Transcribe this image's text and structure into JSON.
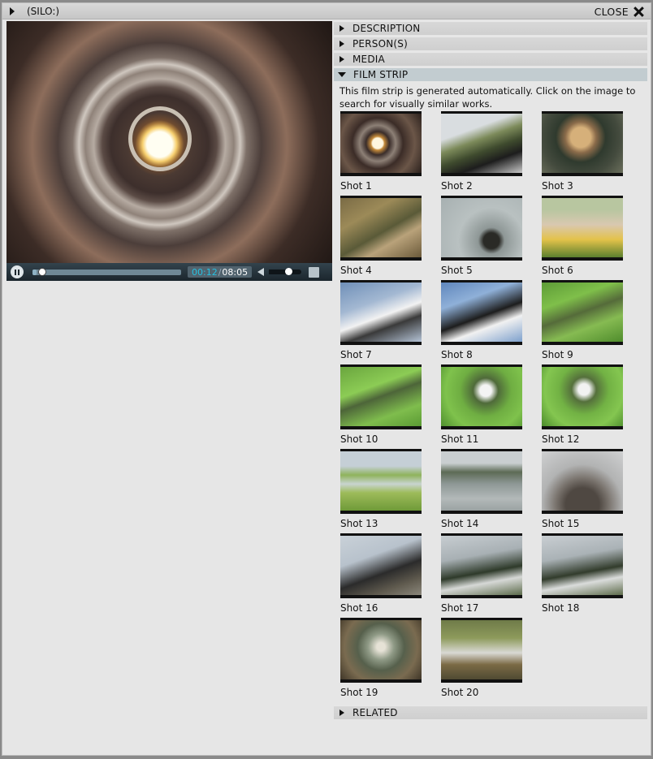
{
  "window": {
    "title": "(SILO:)",
    "close_label": "CLOSE"
  },
  "player": {
    "current_time": "00:12",
    "duration": "08:05",
    "progress": 0.025,
    "volume": 0.6
  },
  "sections": {
    "description": "DESCRIPTION",
    "persons": "PERSON(S)",
    "media": "MEDIA",
    "film_strip": "FILM STRIP",
    "related": "RELATED"
  },
  "film_strip": {
    "note": "This film strip is generated automatically. Click on the image to search for visually similar works.",
    "shots": [
      {
        "label": "Shot 1",
        "bg": "radial-gradient(circle at 46% 50%, #fff7e0 0 10%, #c48a3a 13%, #3a2d2a 22%, #8d8076 34%, #3b2c27 48%, #6b5648 70%, #2a201c)"
      },
      {
        "label": "Shot 2",
        "bg": "linear-gradient(160deg, #d9dde0 0 30%, #7c8a5a 45%, #3f4b2e 60%, #1d1d1d 75%, #c9c9c9)"
      },
      {
        "label": "Shot 3",
        "bg": "radial-gradient(circle at 48% 40%, #d6b07a 0 18%, #8a6b4a 28%, #2f3a2e 45%, #444b3e 70%, #6b6f5c)"
      },
      {
        "label": "Shot 4",
        "bg": "linear-gradient(150deg, #7a6b45 0, #9c8a58 30%, #5a5a38 55%, #b9a27a 70%, #6b5a3a)"
      },
      {
        "label": "Shot 5",
        "bg": "radial-gradient(circle at 62% 72%, #2a2a26 0 12%, #8e9796 20%, #b9c1c1 50%, #a7b0b1)"
      },
      {
        "label": "Shot 6",
        "bg": "linear-gradient(180deg, #b8c6a0 0 20%, #d9c8b0 45%, #e3c24a 70%, #5b7f2e)"
      },
      {
        "label": "Shot 7",
        "bg": "linear-gradient(160deg, #6f8fb8 0, #a3b8d2 35%, #f2f2f2 55%, #3a3a3a 70%, #b4c3d6)"
      },
      {
        "label": "Shot 8",
        "bg": "linear-gradient(160deg, #5f86bc 0, #8fb0d8 30%, #1d1d1d 55%, #f1f1f1 70%, #7da0cc)"
      },
      {
        "label": "Shot 9",
        "bg": "linear-gradient(160deg, #5d9b37 0, #7fbf4a 30%, #556b3a 50%, #86bb52 70%, #4f8c2c)"
      },
      {
        "label": "Shot 10",
        "bg": "linear-gradient(160deg, #6aa53e 0, #8ccc55 35%, #4d6539 50%, #7fbd4d 75%, #5a9a33)"
      },
      {
        "label": "Shot 11",
        "bg": "radial-gradient(circle at 55% 40%, #f4f4f4 0 10%, #4f6a3a 22%, #6fae42 45%, #7fc24c 70%, #4e8e2e)"
      },
      {
        "label": "Shot 12",
        "bg": "radial-gradient(circle at 52% 38%, #f2f2f2 0 10%, #55703c 22%, #72b244 45%, #84c650 70%, #4a8a2b)"
      },
      {
        "label": "Shot 13",
        "bg": "linear-gradient(180deg, #c5cfd6 0 25%, #8fb35c 40%, #c8d4d0 55%, #9dbb5a 70%, #6f9a38)"
      },
      {
        "label": "Shot 14",
        "bg": "linear-gradient(180deg, #c9ced0 0 20%, #5d6b55 35%, #8e9896 55%, #b3b9b9 80%, #9aa2a2)"
      },
      {
        "label": "Shot 15",
        "bg": "radial-gradient(circle at 50% 90%, #4f4842 0 25%, #7b756f 40%, #b2b3b3 60%, #cfd0d1)"
      },
      {
        "label": "Shot 16",
        "bg": "linear-gradient(160deg, #c9d1d8 0, #b8c2cc 35%, #2b2b2b 60%, #5f5a4e 80%, #8c887c)"
      },
      {
        "label": "Shot 17",
        "bg": "linear-gradient(170deg, #c7cdd1 0, #a8b0b4 35%, #2e3a2a 60%, #d6d8d6 75%, #5c6b4b)"
      },
      {
        "label": "Shot 18",
        "bg": "linear-gradient(170deg, #c9ced2 0, #aab2b6 35%, #323c2c 60%, #dadcdb 75%, #5e6c4c)"
      },
      {
        "label": "Shot 19",
        "bg": "radial-gradient(circle at 50% 45%, #e6e2d6 0 8%, #8f9a86 25%, #56604c 45%, #7a6b50 70%, #3f3628)"
      },
      {
        "label": "Shot 20",
        "bg": "linear-gradient(180deg, #6f7b49 0, #8d9a5b 30%, #d9d9d4 55%, #7b6a45 75%, #4f4a32)"
      }
    ]
  }
}
